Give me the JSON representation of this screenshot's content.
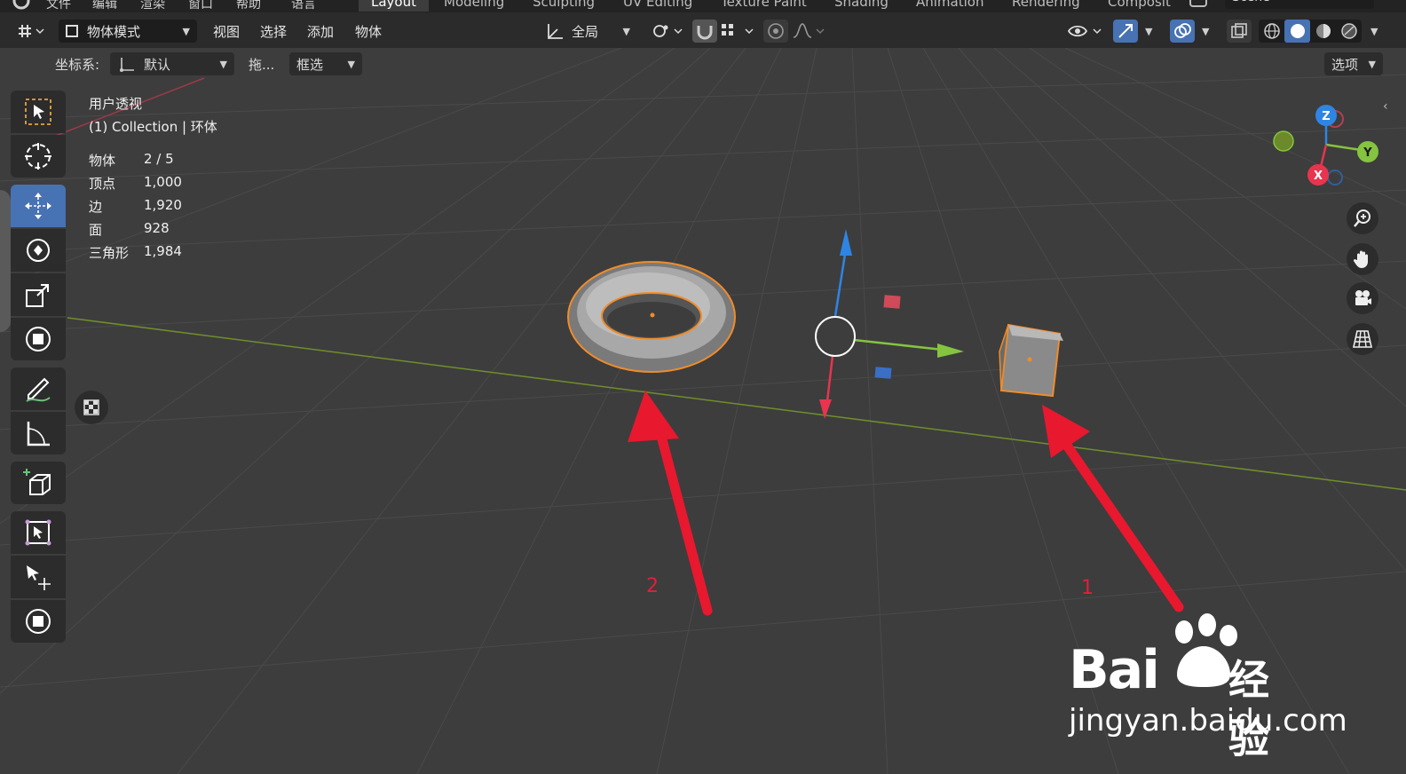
{
  "topbar": {
    "menus": [
      "文件",
      "编辑",
      "渲染",
      "窗口",
      "帮助",
      "语言"
    ],
    "workspaces": [
      "Layout",
      "Modeling",
      "Sculpting",
      "UV Editing",
      "Texture Paint",
      "Shading",
      "Animation",
      "Rendering",
      "Composit"
    ],
    "active_workspace": "Layout",
    "scene": "Scene"
  },
  "header": {
    "mode": "物体模式",
    "menus": [
      "视图",
      "选择",
      "添加",
      "物体"
    ],
    "orientation": "全局"
  },
  "subheader": {
    "coord_label": "坐标系:",
    "coord_value": "默认",
    "drag_label": "拖...",
    "select_mode": "框选",
    "options": "选项"
  },
  "viewport_info": {
    "view_name": "用户透视",
    "collection": "(1) Collection | 环体"
  },
  "stats": [
    {
      "label": "物体",
      "value": "2 / 5"
    },
    {
      "label": "顶点",
      "value": "1,000"
    },
    {
      "label": "边",
      "value": "1,920"
    },
    {
      "label": "面",
      "value": "928"
    },
    {
      "label": "三角形",
      "value": "1,984"
    }
  ],
  "toolbar": {
    "tools": [
      "select-box-tool",
      "cursor-tool",
      "move-tool",
      "rotate-tool",
      "scale-tool",
      "transform-tool",
      "annotate-tool",
      "measure-tool",
      "add-cube-tool",
      "select-transform-tool",
      "origin-move-tool",
      "snap-tool"
    ],
    "active": "move-tool"
  },
  "gizmo": {
    "x": "X",
    "y": "Y",
    "z": "Z"
  },
  "annotations": {
    "arrow_1": "1",
    "arrow_2": "2"
  },
  "watermark": {
    "brand": "Bai",
    "brand_cn": "经验",
    "url": "jingyan.baidu.com"
  },
  "colors": {
    "accent": "#4772b3",
    "selection": "#f08c2a",
    "x_axis": "#e8344e",
    "y_axis": "#85c440",
    "z_axis": "#2f85e3",
    "arrow": "#e8182f"
  }
}
